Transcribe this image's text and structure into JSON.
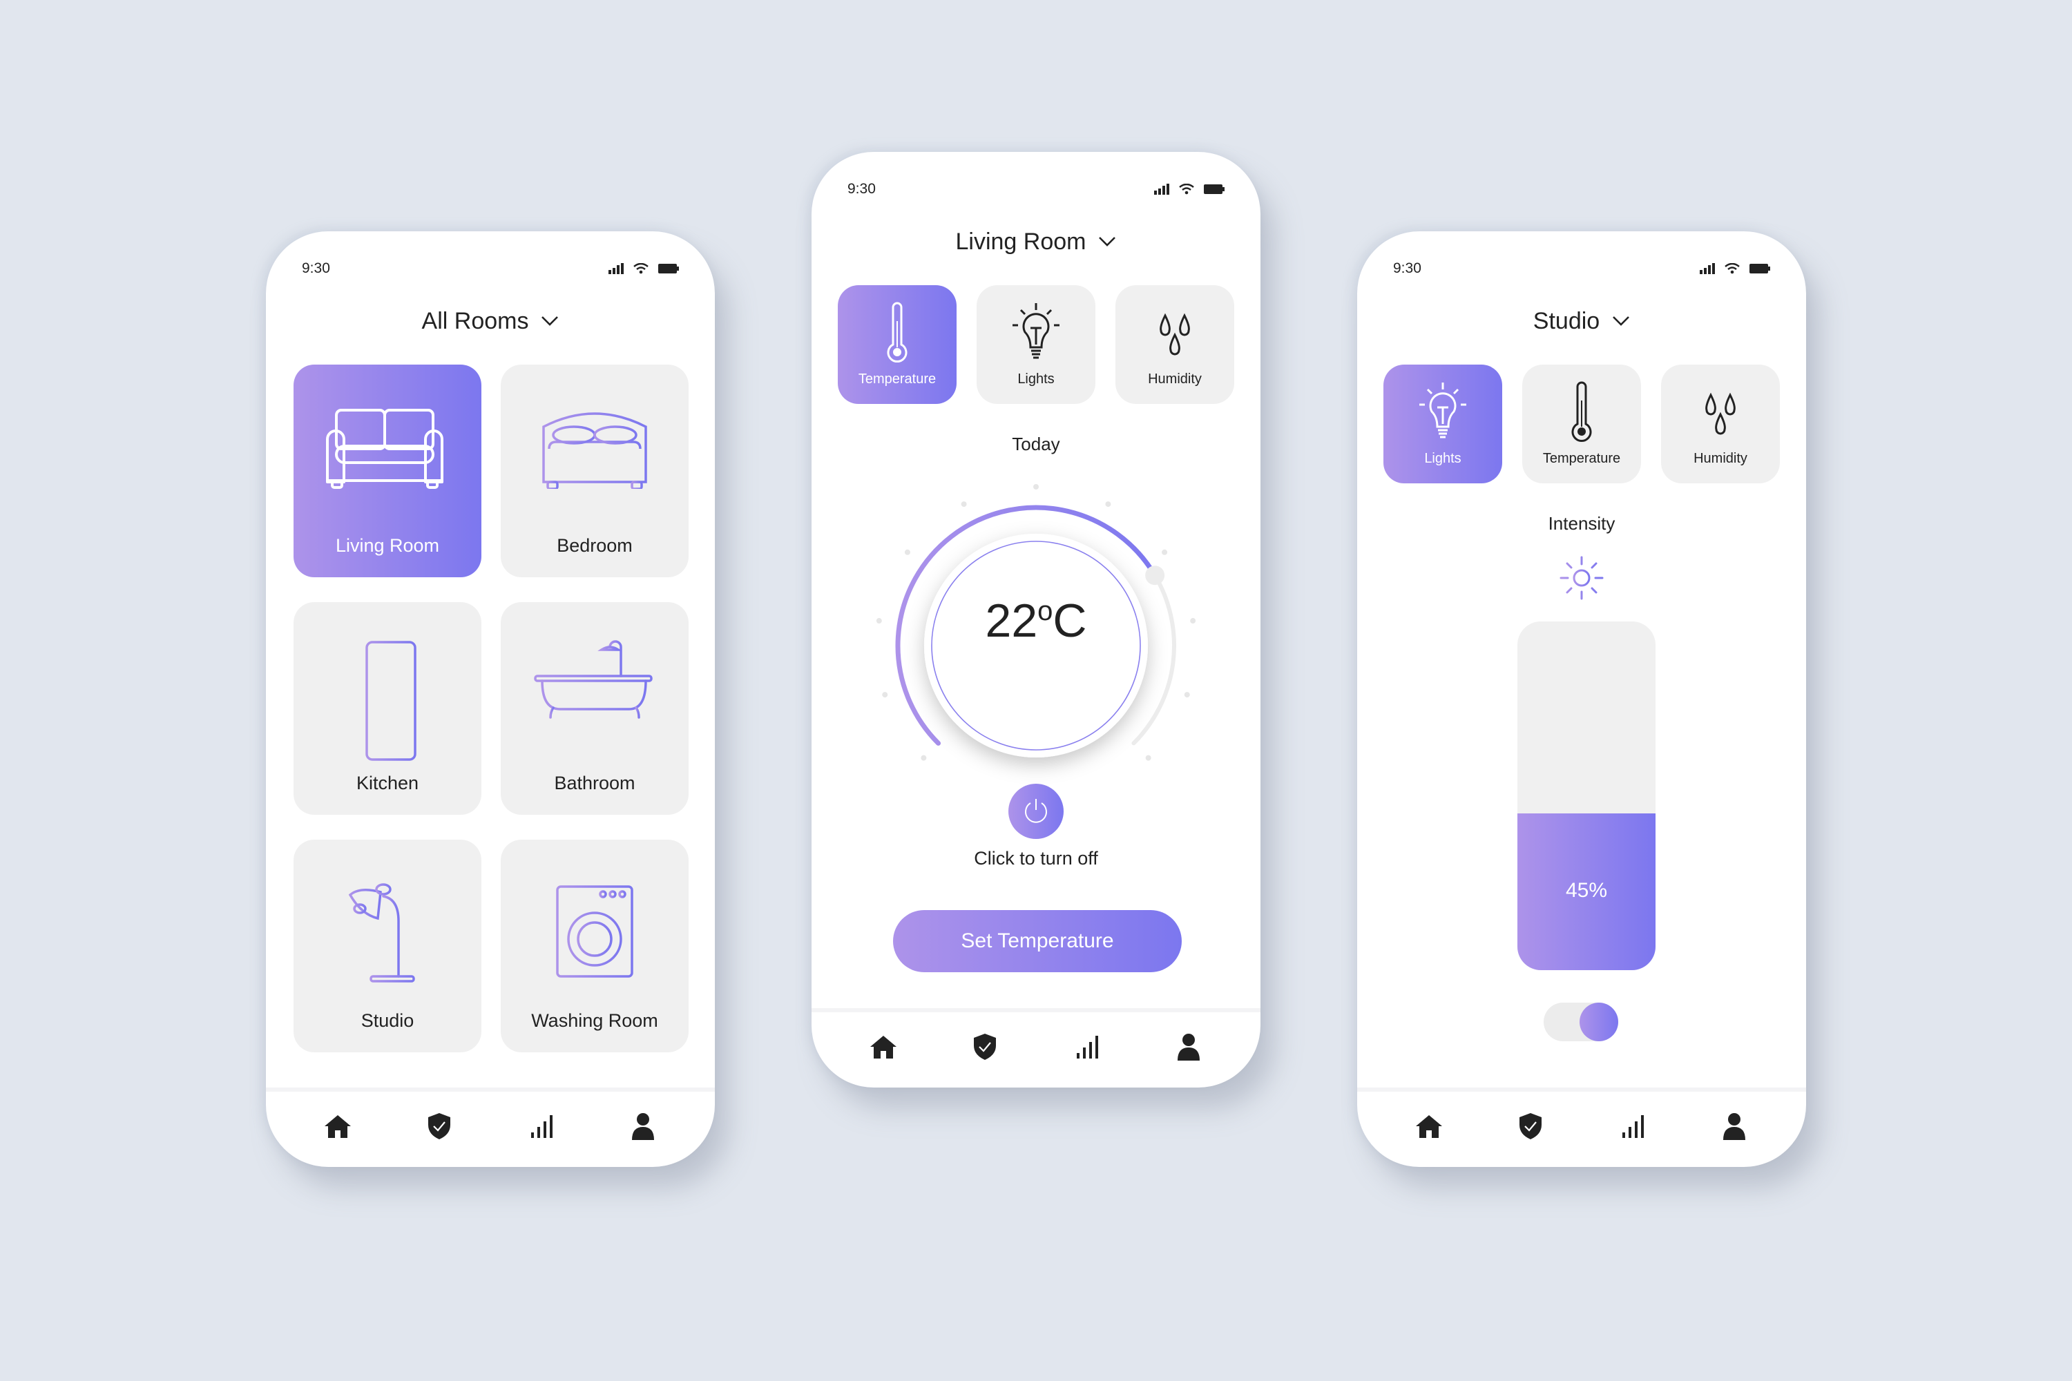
{
  "theme": {
    "accent_start": "#ad93ea",
    "accent_end": "#7c77ef",
    "card_bg": "#f0f0f0",
    "page_bg": "#e1e6ee",
    "text": "#222222"
  },
  "status_bar": {
    "time": "9:30",
    "icons": [
      "signal-icon",
      "wifi-icon",
      "battery-icon"
    ]
  },
  "bottom_nav": {
    "items": [
      {
        "icon": "home-icon",
        "label": "Home"
      },
      {
        "icon": "shield-check-icon",
        "label": "Security"
      },
      {
        "icon": "stats-icon",
        "label": "Statistics"
      },
      {
        "icon": "user-icon",
        "label": "Profile"
      }
    ]
  },
  "rooms_screen": {
    "header": {
      "title": "All Rooms",
      "dropdown_icon": "chevron-down-icon"
    },
    "rooms": [
      {
        "label": "Living Room",
        "icon": "sofa-icon",
        "active": true
      },
      {
        "label": "Bedroom",
        "icon": "bed-icon",
        "active": false
      },
      {
        "label": "Kitchen",
        "icon": "fridge-icon",
        "active": false
      },
      {
        "label": "Bathroom",
        "icon": "bathtub-icon",
        "active": false
      },
      {
        "label": "Studio",
        "icon": "desk-lamp-icon",
        "active": false
      },
      {
        "label": "Washing Room",
        "icon": "washing-machine-icon",
        "active": false
      }
    ]
  },
  "temperature_screen": {
    "header": {
      "title": "Living Room",
      "dropdown_icon": "chevron-down-icon"
    },
    "tabs": [
      {
        "label": "Temperature",
        "icon": "thermometer-icon",
        "active": true
      },
      {
        "label": "Lights",
        "icon": "lightbulb-icon",
        "active": false
      },
      {
        "label": "Humidity",
        "icon": "droplets-icon",
        "active": false
      }
    ],
    "period_label": "Today",
    "temperature": {
      "value": "22",
      "unit_degree": "o",
      "unit": "C",
      "dial_fraction": 0.72
    },
    "power_caption": "Click to turn off",
    "set_button_label": "Set Temperature"
  },
  "lights_screen": {
    "header": {
      "title": "Studio",
      "dropdown_icon": "chevron-down-icon"
    },
    "tabs": [
      {
        "label": "Lights",
        "icon": "lightbulb-icon",
        "active": true
      },
      {
        "label": "Temperature",
        "icon": "thermometer-icon",
        "active": false
      },
      {
        "label": "Humidity",
        "icon": "droplets-icon",
        "active": false
      }
    ],
    "intensity_label": "Intensity",
    "intensity": {
      "percent": 45,
      "display": "45%"
    },
    "toggle_on": true
  }
}
